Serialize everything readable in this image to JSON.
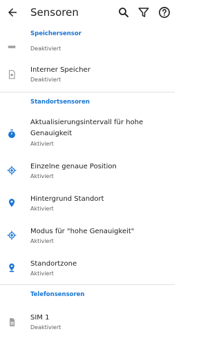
{
  "appbar": {
    "title": "Sensoren"
  },
  "colors": {
    "accent": "#1976d2",
    "icon_grey": "#9e9e9e"
  },
  "sections": {
    "speicher": "Speichersensor",
    "standort": "Standortsensoren",
    "telefon": "Telefonsensoren"
  },
  "items": [
    {
      "title": "",
      "subtitle": "Deaktiviert",
      "icon": "storage-bar-icon"
    },
    {
      "title": "Interner Speicher",
      "subtitle": "Deaktiviert",
      "icon": "sd-card-icon"
    },
    {
      "title": "Aktualisierungsintervall für hohe",
      "title2": "Genauigkeit",
      "subtitle": "Aktiviert",
      "icon": "timer-icon"
    },
    {
      "title": "Einzelne genaue Position",
      "subtitle": "Aktiviert",
      "icon": "gps-fixed-icon"
    },
    {
      "title": "Hintergrund Standort",
      "subtitle": "Aktiviert",
      "icon": "location-pin-icon"
    },
    {
      "title": "Modus für \"hohe Genauigkeit\"",
      "subtitle": "Aktiviert",
      "icon": "gps-fixed-icon"
    },
    {
      "title": "Standortzone",
      "subtitle": "Aktiviert",
      "icon": "person-pin-icon"
    },
    {
      "title": "SIM 1",
      "subtitle": "Deaktiviert",
      "icon": "sim-card-icon"
    }
  ]
}
